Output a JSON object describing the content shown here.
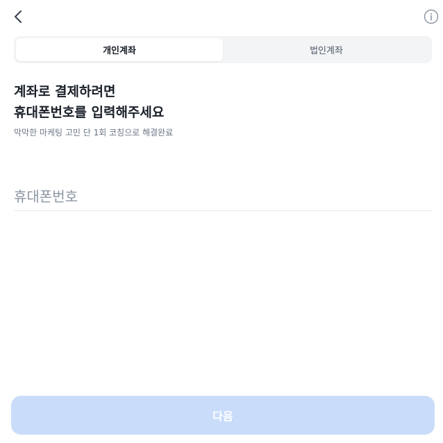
{
  "header": {
    "back_icon": "chevron-left-icon",
    "info_icon": "info-circle-icon"
  },
  "tabs": [
    {
      "label": "개인계좌",
      "active": true
    },
    {
      "label": "법인계좌",
      "active": false
    }
  ],
  "main": {
    "headline_line1": "계좌로 결제하려면",
    "headline_line2": "휴대폰번호를 입력해주세요",
    "subtext": "막막한 마케팅 고민 단 1회 코칭으로 해결완료",
    "phone_input": {
      "placeholder": "휴대폰번호",
      "value": ""
    }
  },
  "footer": {
    "next_label": "다음",
    "next_enabled": false
  },
  "colors": {
    "tab_bg": "#f2f4f6",
    "button_disabled": "#c9dcfa",
    "text_primary": "#191f28",
    "text_secondary": "#6b7684",
    "placeholder": "#8b95a1"
  }
}
